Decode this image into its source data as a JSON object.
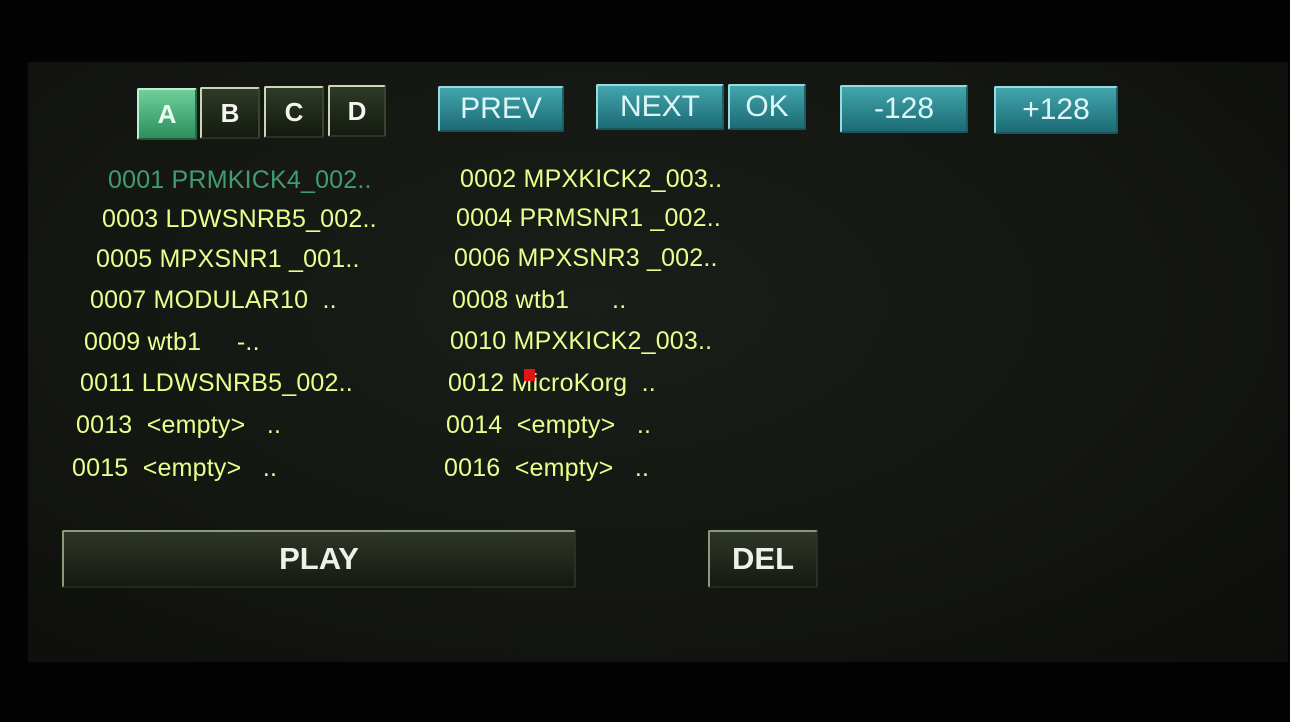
{
  "banks": [
    "A",
    "B",
    "C",
    "D"
  ],
  "active_bank": "A",
  "nav": {
    "prev": "PREV",
    "next": "NEXT",
    "ok": "OK",
    "minus": "-128",
    "plus": "+128"
  },
  "slots": [
    "0001 PRMKICK4_002..",
    "0002 MPXKICK2_003..",
    "0003 LDWSNRB5_002..",
    "0004 PRMSNR1 _002..",
    "0005 MPXSNR1 _001..",
    "0006 MPXSNR3 _002..",
    "0007 MODULAR10  ..",
    "0008 wtb1      ..",
    "0009 wtb1     -..",
    "0010 MPXKICK2_003..",
    "0011 LDWSNRB5_002..",
    "0012 MicroKorg  ..",
    "0013  <empty>   ..",
    "0014  <empty>   ..",
    "0015  <empty>   ..",
    "0016  <empty>   .."
  ],
  "current_slot": "0001",
  "actions": {
    "play": "PLAY",
    "del": "DEL"
  },
  "colors": {
    "slot_text": "#e6ff8e",
    "current_slot_text": "#3f9d72",
    "active_bank": "#3fae78",
    "teal_button": "#2f8b93",
    "marker": "#e01616"
  }
}
